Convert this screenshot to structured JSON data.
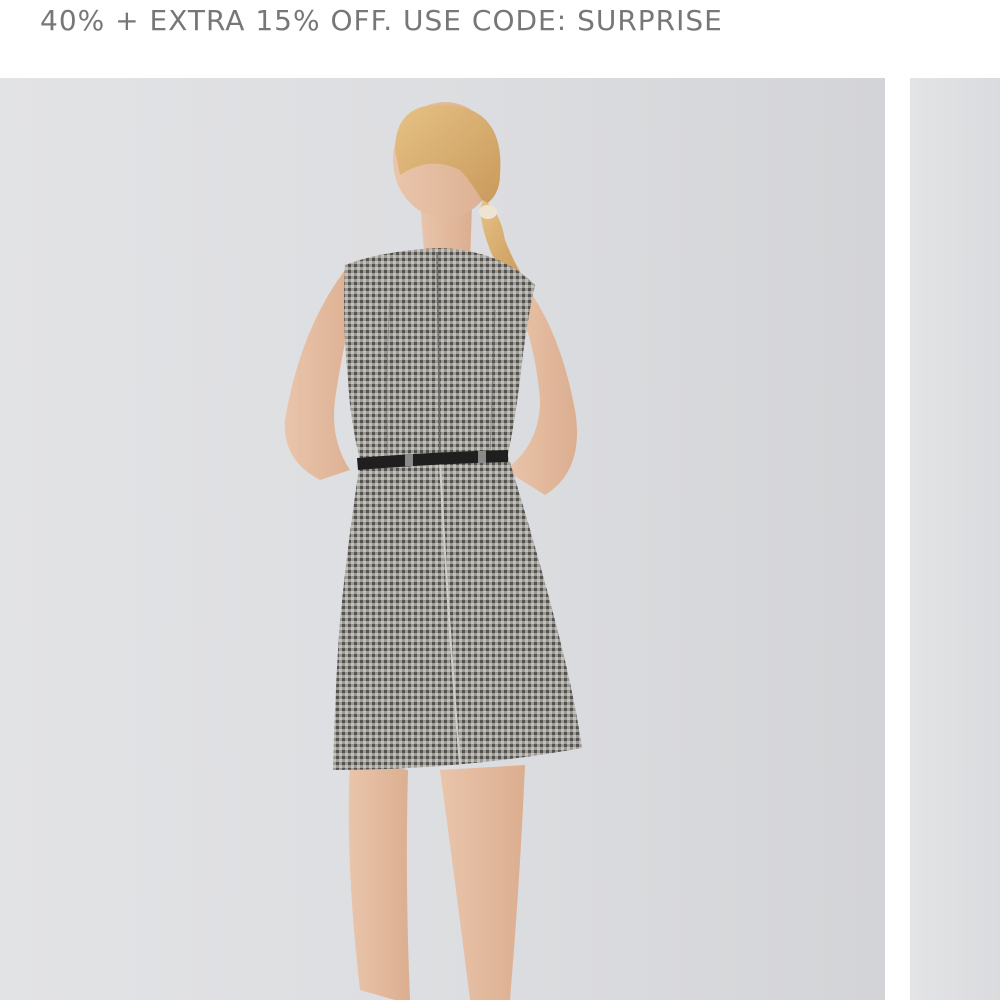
{
  "promo": {
    "text": "40% + EXTRA 15% OFF. USE CODE: SURPRISE"
  },
  "gallery": {
    "images": [
      {
        "subject": "model wearing sleeveless houndstooth belted dress, back view"
      },
      {
        "subject": "next product image, partially visible"
      }
    ]
  },
  "colors": {
    "promo_text": "#777777",
    "image_background": "#dcdde0",
    "dress_base": "#8c8a86",
    "belt": "#1f1f1f",
    "skin": "#e7bfa3",
    "hair": "#d9ae6e"
  }
}
